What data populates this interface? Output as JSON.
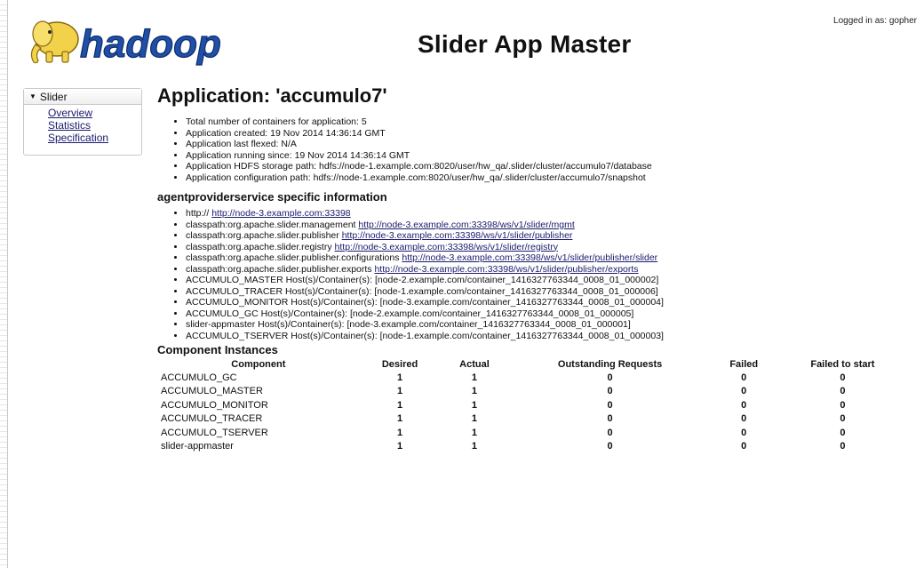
{
  "header": {
    "logo_text": "hadoop",
    "title": "Slider App Master",
    "logged_in": "Logged in as: gopher"
  },
  "sidebar": {
    "section_label": "Slider",
    "links": [
      "Overview",
      "Statistics",
      "Specification"
    ]
  },
  "application": {
    "title": "Application: 'accumulo7'",
    "info": [
      "Total number of containers for application: 5",
      "Application created: 19 Nov 2014 14:36:14 GMT",
      "Application last flexed: N/A",
      "Application running since: 19 Nov 2014 14:36:14 GMT",
      "Application HDFS storage path: hdfs://node-1.example.com:8020/user/hw_qa/.slider/cluster/accumulo7/database",
      "Application configuration path: hdfs://node-1.example.com:8020/user/hw_qa/.slider/cluster/accumulo7/snapshot"
    ]
  },
  "provider": {
    "title": "agentproviderservice specific information",
    "links": [
      {
        "label": "http://",
        "url": "http://node-3.example.com:33398"
      },
      {
        "label": "classpath:org.apache.slider.management",
        "url": "http://node-3.example.com:33398/ws/v1/slider/mgmt"
      },
      {
        "label": "classpath:org.apache.slider.publisher",
        "url": "http://node-3.example.com:33398/ws/v1/slider/publisher"
      },
      {
        "label": "classpath:org.apache.slider.registry",
        "url": "http://node-3.example.com:33398/ws/v1/slider/registry"
      },
      {
        "label": "classpath:org.apache.slider.publisher.configurations",
        "url": "http://node-3.example.com:33398/ws/v1/slider/publisher/slider"
      },
      {
        "label": "classpath:org.apache.slider.publisher.exports",
        "url": "http://node-3.example.com:33398/ws/v1/slider/publisher/exports"
      }
    ],
    "hosts": [
      "ACCUMULO_MASTER Host(s)/Container(s): [node-2.example.com/container_1416327763344_0008_01_000002]",
      "ACCUMULO_TRACER Host(s)/Container(s): [node-1.example.com/container_1416327763344_0008_01_000006]",
      "ACCUMULO_MONITOR Host(s)/Container(s): [node-3.example.com/container_1416327763344_0008_01_000004]",
      "ACCUMULO_GC Host(s)/Container(s): [node-2.example.com/container_1416327763344_0008_01_000005]",
      "slider-appmaster Host(s)/Container(s): [node-3.example.com/container_1416327763344_0008_01_000001]",
      "ACCUMULO_TSERVER Host(s)/Container(s): [node-1.example.com/container_1416327763344_0008_01_000003]"
    ]
  },
  "components": {
    "title": "Component Instances",
    "columns": [
      "Component",
      "Desired",
      "Actual",
      "Outstanding Requests",
      "Failed",
      "Failed to start"
    ],
    "rows": [
      [
        "ACCUMULO_GC",
        "1",
        "1",
        "0",
        "0",
        "0"
      ],
      [
        "ACCUMULO_MASTER",
        "1",
        "1",
        "0",
        "0",
        "0"
      ],
      [
        "ACCUMULO_MONITOR",
        "1",
        "1",
        "0",
        "0",
        "0"
      ],
      [
        "ACCUMULO_TRACER",
        "1",
        "1",
        "0",
        "0",
        "0"
      ],
      [
        "ACCUMULO_TSERVER",
        "1",
        "1",
        "0",
        "0",
        "0"
      ],
      [
        "slider-appmaster",
        "1",
        "1",
        "0",
        "0",
        "0"
      ]
    ]
  }
}
